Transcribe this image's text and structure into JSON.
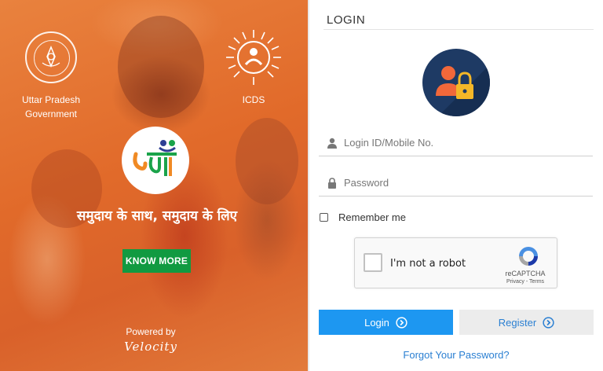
{
  "hero": {
    "gov_label_line1": "Uttar Pradesh",
    "gov_label_line2": "Government",
    "icds_label": "ICDS",
    "tagline": "समुदाय के साथ, समुदाय के लिए",
    "know_more_label": "KNOW MORE",
    "powered_by": "Powered by",
    "velocity": "Velocity",
    "brand_color": "#e16a2a",
    "button_color": "#119a41"
  },
  "login": {
    "title": "LOGIN",
    "login_id_placeholder": "Login ID/Mobile No.",
    "login_id_value": "",
    "password_placeholder": "Password",
    "password_value": "",
    "remember_label": "Remember me",
    "remember_checked": false,
    "recaptcha": {
      "label": "I'm not a robot",
      "brand": "reCAPTCHA",
      "links": "Privacy - Terms"
    },
    "login_button": "Login",
    "register_button": "Register",
    "forgot_link": "Forgot Your Password?",
    "accent_color": "#1d97f1",
    "avatar_bg": "#1e3a64"
  }
}
